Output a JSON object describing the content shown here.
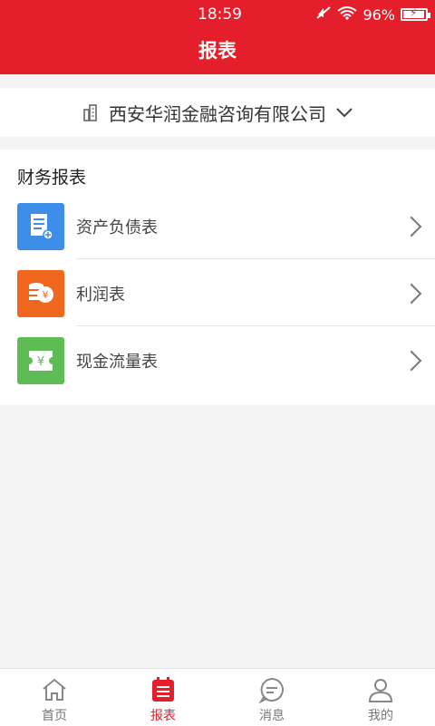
{
  "status": {
    "time": "18:59",
    "battery": "96%",
    "battery_level": 0.96
  },
  "header": {
    "title": "报表"
  },
  "company": {
    "name": "西安华润金融咨询有限公司"
  },
  "finance": {
    "section_title": "财务报表",
    "items": [
      {
        "label": "资产负债表",
        "icon": "document-icon",
        "color": "#3c8ee9"
      },
      {
        "label": "利润表",
        "icon": "coins-icon",
        "color": "#f1671d"
      },
      {
        "label": "现金流量表",
        "icon": "cash-ticket-icon",
        "color": "#5fbc55"
      }
    ]
  },
  "tabs": [
    {
      "label": "首页",
      "icon": "home-icon"
    },
    {
      "label": "报表",
      "icon": "report-icon",
      "active": true
    },
    {
      "label": "消息",
      "icon": "message-icon"
    },
    {
      "label": "我的",
      "icon": "user-icon"
    }
  ]
}
